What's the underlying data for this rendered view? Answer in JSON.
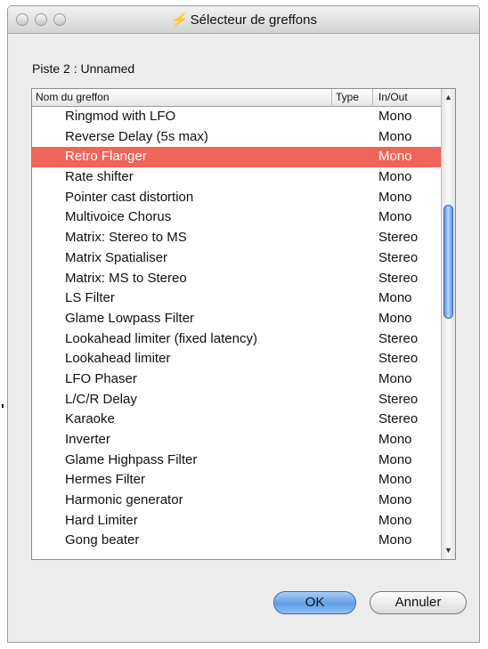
{
  "window": {
    "title": "Sélecteur de greffons",
    "app_icon": "plugin-selector-icon"
  },
  "track": {
    "label": "Piste 2 :  Unnamed"
  },
  "list": {
    "columns": {
      "name": "Nom du greffon",
      "type": "Type",
      "io": "In/Out"
    },
    "rows": [
      {
        "name": "Ringmod with LFO",
        "type": "",
        "io": "Mono"
      },
      {
        "name": "Reverse Delay (5s max)",
        "type": "",
        "io": "Mono"
      },
      {
        "name": "Retro Flanger",
        "type": "",
        "io": "Mono",
        "selected": true
      },
      {
        "name": "Rate shifter",
        "type": "",
        "io": "Mono"
      },
      {
        "name": "Pointer cast distortion",
        "type": "",
        "io": "Mono"
      },
      {
        "name": "Multivoice Chorus",
        "type": "",
        "io": "Mono"
      },
      {
        "name": "Matrix: Stereo to MS",
        "type": "",
        "io": "Stereo"
      },
      {
        "name": "Matrix Spatialiser",
        "type": "",
        "io": "Stereo"
      },
      {
        "name": "Matrix: MS to Stereo",
        "type": "",
        "io": "Stereo"
      },
      {
        "name": "LS Filter",
        "type": "",
        "io": "Mono"
      },
      {
        "name": "Glame Lowpass Filter",
        "type": "",
        "io": "Mono"
      },
      {
        "name": "Lookahead limiter (fixed latency)",
        "type": "",
        "io": "Stereo"
      },
      {
        "name": "Lookahead limiter",
        "type": "",
        "io": "Stereo"
      },
      {
        "name": "LFO Phaser",
        "type": "",
        "io": "Mono"
      },
      {
        "name": "L/C/R Delay",
        "type": "",
        "io": "Stereo"
      },
      {
        "name": "Karaoke",
        "type": "",
        "io": "Stereo"
      },
      {
        "name": "Inverter",
        "type": "",
        "io": "Mono"
      },
      {
        "name": "Glame Highpass Filter",
        "type": "",
        "io": "Mono"
      },
      {
        "name": "Hermes Filter",
        "type": "",
        "io": "Mono"
      },
      {
        "name": "Harmonic generator",
        "type": "",
        "io": "Mono"
      },
      {
        "name": "Hard Limiter",
        "type": "",
        "io": "Mono"
      },
      {
        "name": "Gong beater",
        "type": "",
        "io": "Mono"
      }
    ],
    "selection_color": "#f0645a"
  },
  "buttons": {
    "ok": "OK",
    "cancel": "Annuler"
  }
}
